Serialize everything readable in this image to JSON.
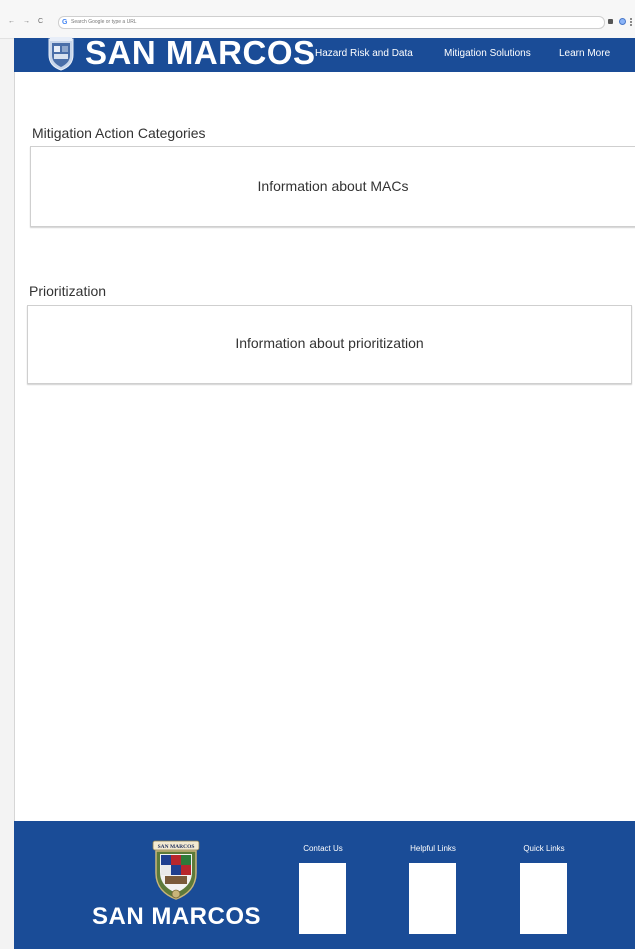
{
  "browser": {
    "back_icon": "←",
    "forward_icon": "→",
    "reload_icon": "C",
    "google_icon": "G",
    "address_placeholder": "Search Google or type a URL"
  },
  "header": {
    "logo_text": "SAN MARCOS",
    "nav": [
      {
        "label": "Hazard Risk and Data"
      },
      {
        "label": "Mitigation Solutions"
      },
      {
        "label": "Learn More"
      }
    ],
    "color": "#1a4c97"
  },
  "sections": [
    {
      "title": "Mitigation Action Categories",
      "card_text": "Information about MACs"
    },
    {
      "title": "Prioritization",
      "card_text": "Information about prioritization"
    }
  ],
  "footer": {
    "seal_text": "SAN MARCOS",
    "logo_text": "SAN MARCOS",
    "columns": [
      {
        "title": "Contact Us"
      },
      {
        "title": "Helpful Links"
      },
      {
        "title": "Quick Links"
      }
    ]
  }
}
